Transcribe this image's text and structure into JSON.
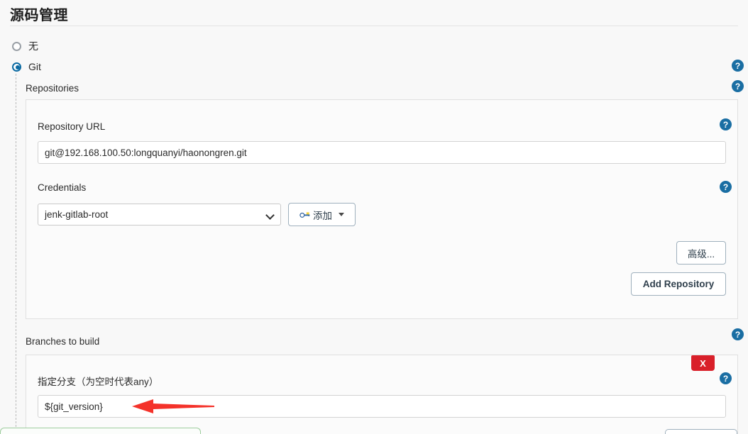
{
  "section": {
    "title": "源码管理"
  },
  "scm_options": [
    {
      "label": "无",
      "selected": false
    },
    {
      "label": "Git",
      "selected": true
    }
  ],
  "git": {
    "repositories_label": "Repositories",
    "repository_url_label": "Repository URL",
    "repository_url_value": "git@192.168.100.50:longquanyi/haonongren.git",
    "credentials_label": "Credentials",
    "credentials_value": "jenk-gitlab-root",
    "add_credentials_label": "添加",
    "advanced_label": "高级...",
    "add_repository_label": "Add Repository",
    "branches_label": "Branches to build",
    "branch_specifier_label": "指定分支（为空时代表any）",
    "branch_specifier_value": "${git_version}",
    "delete_label": "X"
  },
  "help_label": "?",
  "colors": {
    "accent_blue": "#1a6ea3",
    "radio_blue": "#0b6aa2",
    "delete_red": "#d9202a",
    "annotation_red": "#f4322a",
    "green_border": "#9ccc9c",
    "page_bg": "#f8f8f8",
    "panel_bg": "#fbfbfb"
  }
}
